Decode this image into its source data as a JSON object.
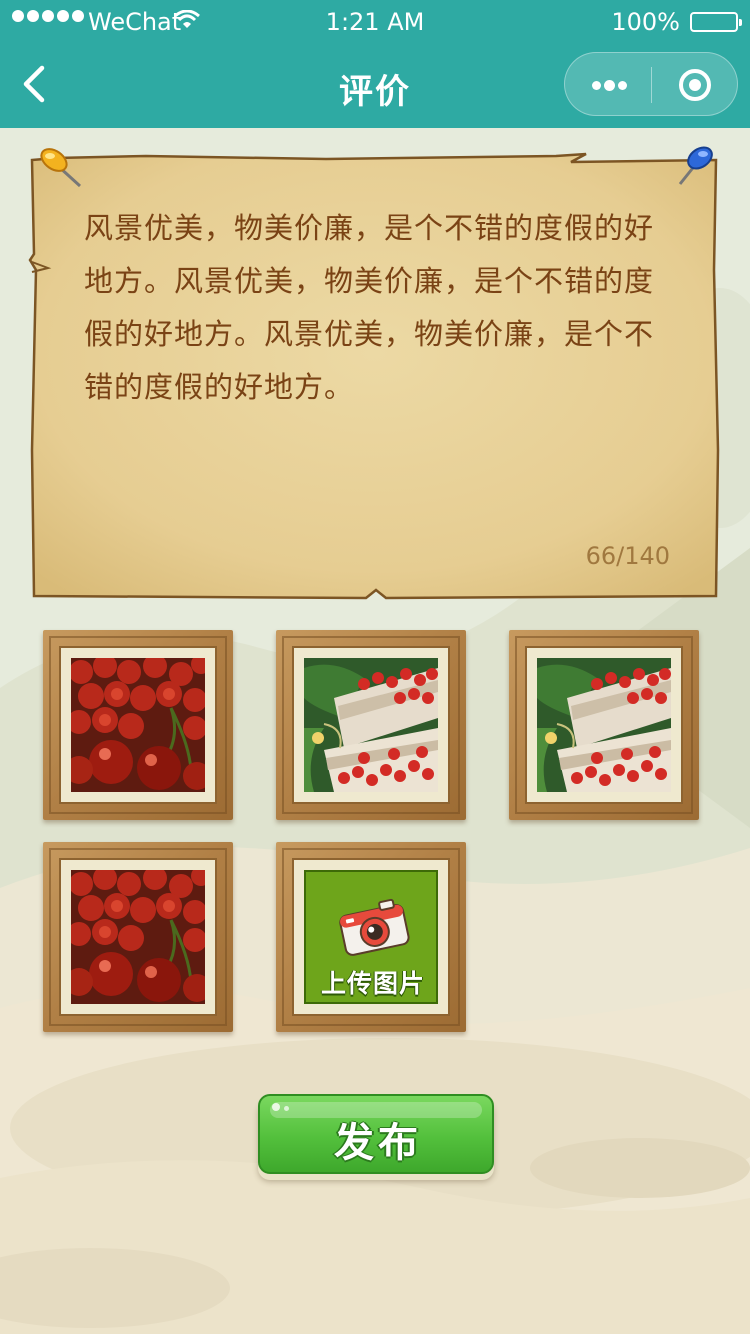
{
  "status_bar": {
    "carrier": "WeChat",
    "time": "1:21 AM",
    "battery": "100%"
  },
  "nav": {
    "title": "评价",
    "back_icon": "chevron-left-icon",
    "more_icon": "more-dots-icon",
    "close_icon": "target-circle-icon"
  },
  "review": {
    "text": "风景优美，物美价廉，是个不错的度假的好地方。风景优美，物美价廉，是个不错的度假的好地方。风景优美，物美价廉，是个不错的度假的好地方。",
    "counter": "66/140"
  },
  "photos": [
    {
      "subject": "cherries-closeup"
    },
    {
      "subject": "cherries-in-crate"
    },
    {
      "subject": "cherries-in-crate"
    },
    {
      "subject": "cherries-closeup"
    }
  ],
  "upload": {
    "label": "上传图片",
    "icon": "camera-icon"
  },
  "publish": {
    "label": "发布"
  },
  "colors": {
    "nav_bg": "#2eaaa3",
    "review_text": "#7a4315",
    "counter_text": "#a0783f",
    "publish_green": "#53c03c",
    "upload_green": "#6ea51b"
  }
}
